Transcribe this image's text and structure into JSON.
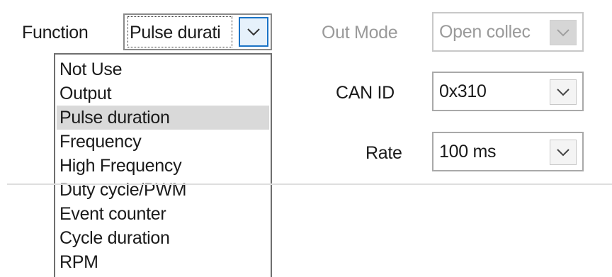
{
  "function_field": {
    "label": "Function",
    "value": "Pulse durati"
  },
  "function_dropdown": {
    "options": [
      "Not Use",
      "Output",
      "Pulse duration",
      "Frequency",
      "High Frequency",
      "Duty cycle/PWM",
      "Event counter",
      "Cycle duration",
      "RPM"
    ],
    "selected": "Pulse duration"
  },
  "out_mode": {
    "label": "Out Mode",
    "value": "Open collec",
    "enabled": false
  },
  "can_id": {
    "label": "CAN ID",
    "value": "0x310"
  },
  "rate": {
    "label": "Rate",
    "value": "100 ms"
  },
  "icons": {
    "dropdown_arrow": "chevron-down-icon"
  },
  "colors": {
    "focus_border": "#1a73c6",
    "selected_item_bg": "#d9d9d9",
    "disabled_text": "#9a9a9a"
  }
}
